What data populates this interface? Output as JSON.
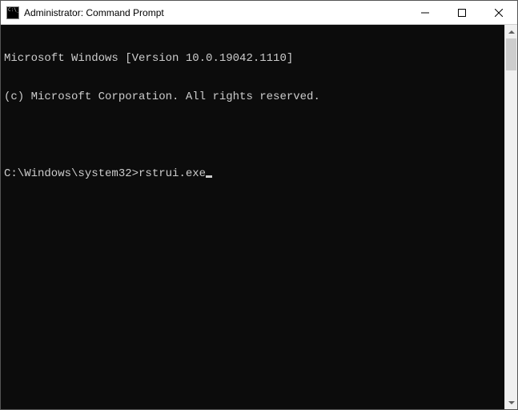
{
  "window": {
    "title": "Administrator: Command Prompt"
  },
  "terminal": {
    "line1": "Microsoft Windows [Version 10.0.19042.1110]",
    "line2": "(c) Microsoft Corporation. All rights reserved.",
    "prompt": "C:\\Windows\\system32>",
    "command": "rstrui.exe"
  },
  "icons": {
    "cmd": "cmd-icon",
    "minimize": "minimize-icon",
    "maximize": "maximize-icon",
    "close": "close-icon",
    "scroll_up": "scroll-up-icon",
    "scroll_down": "scroll-down-icon"
  }
}
